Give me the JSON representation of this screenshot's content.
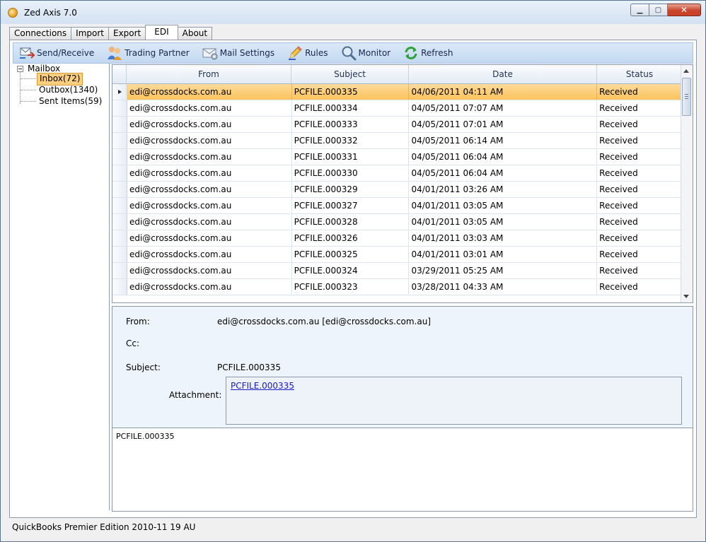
{
  "window": {
    "title": "Zed Axis 7.0",
    "min_label": "▁",
    "max_label": "▢",
    "close_label": "✕"
  },
  "tabs": [
    {
      "label": "Connections",
      "active": false
    },
    {
      "label": "Import",
      "active": false
    },
    {
      "label": "Export",
      "active": false
    },
    {
      "label": "EDI",
      "active": true
    },
    {
      "label": "About",
      "active": false
    }
  ],
  "toolbar": {
    "items": [
      {
        "label": "Send/Receive",
        "icon": "send-receive-icon"
      },
      {
        "label": "Trading Partner",
        "icon": "trading-partner-icon"
      },
      {
        "label": "Mail Settings",
        "icon": "mail-settings-icon"
      },
      {
        "label": "Rules",
        "icon": "rules-pencil-icon"
      },
      {
        "label": "Monitor",
        "icon": "monitor-magnifier-icon"
      },
      {
        "label": "Refresh",
        "icon": "refresh-icon"
      }
    ]
  },
  "tree": {
    "root": "Mailbox",
    "items": [
      {
        "label": "Inbox(72)",
        "selected": true
      },
      {
        "label": "Outbox(1340)",
        "selected": false
      },
      {
        "label": "Sent Items(59)",
        "selected": false
      }
    ]
  },
  "grid": {
    "columns": [
      "From",
      "Subject",
      "Date",
      "Status"
    ],
    "rows": [
      {
        "from": "edi@crossdocks.com.au",
        "subject": "PCFILE.000335",
        "date": "04/06/2011 04:11 AM",
        "status": "Received",
        "selected": true
      },
      {
        "from": "edi@crossdocks.com.au",
        "subject": "PCFILE.000334",
        "date": "04/05/2011 07:07 AM",
        "status": "Received"
      },
      {
        "from": "edi@crossdocks.com.au",
        "subject": "PCFILE.000333",
        "date": "04/05/2011 07:01 AM",
        "status": "Received"
      },
      {
        "from": "edi@crossdocks.com.au",
        "subject": "PCFILE.000332",
        "date": "04/05/2011 06:14 AM",
        "status": "Received"
      },
      {
        "from": "edi@crossdocks.com.au",
        "subject": "PCFILE.000331",
        "date": "04/05/2011 06:04 AM",
        "status": "Received"
      },
      {
        "from": "edi@crossdocks.com.au",
        "subject": "PCFILE.000330",
        "date": "04/05/2011 06:04 AM",
        "status": "Received"
      },
      {
        "from": "edi@crossdocks.com.au",
        "subject": "PCFILE.000329",
        "date": "04/01/2011 03:26 AM",
        "status": "Received"
      },
      {
        "from": "edi@crossdocks.com.au",
        "subject": "PCFILE.000327",
        "date": "04/01/2011 03:05 AM",
        "status": "Received"
      },
      {
        "from": "edi@crossdocks.com.au",
        "subject": "PCFILE.000328",
        "date": "04/01/2011 03:05 AM",
        "status": "Received"
      },
      {
        "from": "edi@crossdocks.com.au",
        "subject": "PCFILE.000326",
        "date": "04/01/2011 03:03 AM",
        "status": "Received"
      },
      {
        "from": "edi@crossdocks.com.au",
        "subject": "PCFILE.000325",
        "date": "04/01/2011 03:01 AM",
        "status": "Received"
      },
      {
        "from": "edi@crossdocks.com.au",
        "subject": "PCFILE.000324",
        "date": "03/29/2011 05:25 AM",
        "status": "Received"
      },
      {
        "from": "edi@crossdocks.com.au",
        "subject": "PCFILE.000323",
        "date": "03/28/2011 04:33 AM",
        "status": "Received"
      }
    ]
  },
  "detail": {
    "from_label": "From:",
    "from_value": "edi@crossdocks.com.au [edi@crossdocks.com.au]",
    "cc_label": "Cc:",
    "cc_value": "",
    "subject_label": "Subject:",
    "subject_value": "PCFILE.000335",
    "attachment_label": "Attachment:",
    "attachment_link": "PCFILE.000335"
  },
  "body_text": "PCFILE.000335",
  "statusbar": "QuickBooks Premier Edition 2010-11  19  AU",
  "colors": {
    "selection": "#fbc35c",
    "toolbar": "#c2d8f1",
    "detail_bg": "#edf4fc",
    "link": "#1a1ac0"
  }
}
